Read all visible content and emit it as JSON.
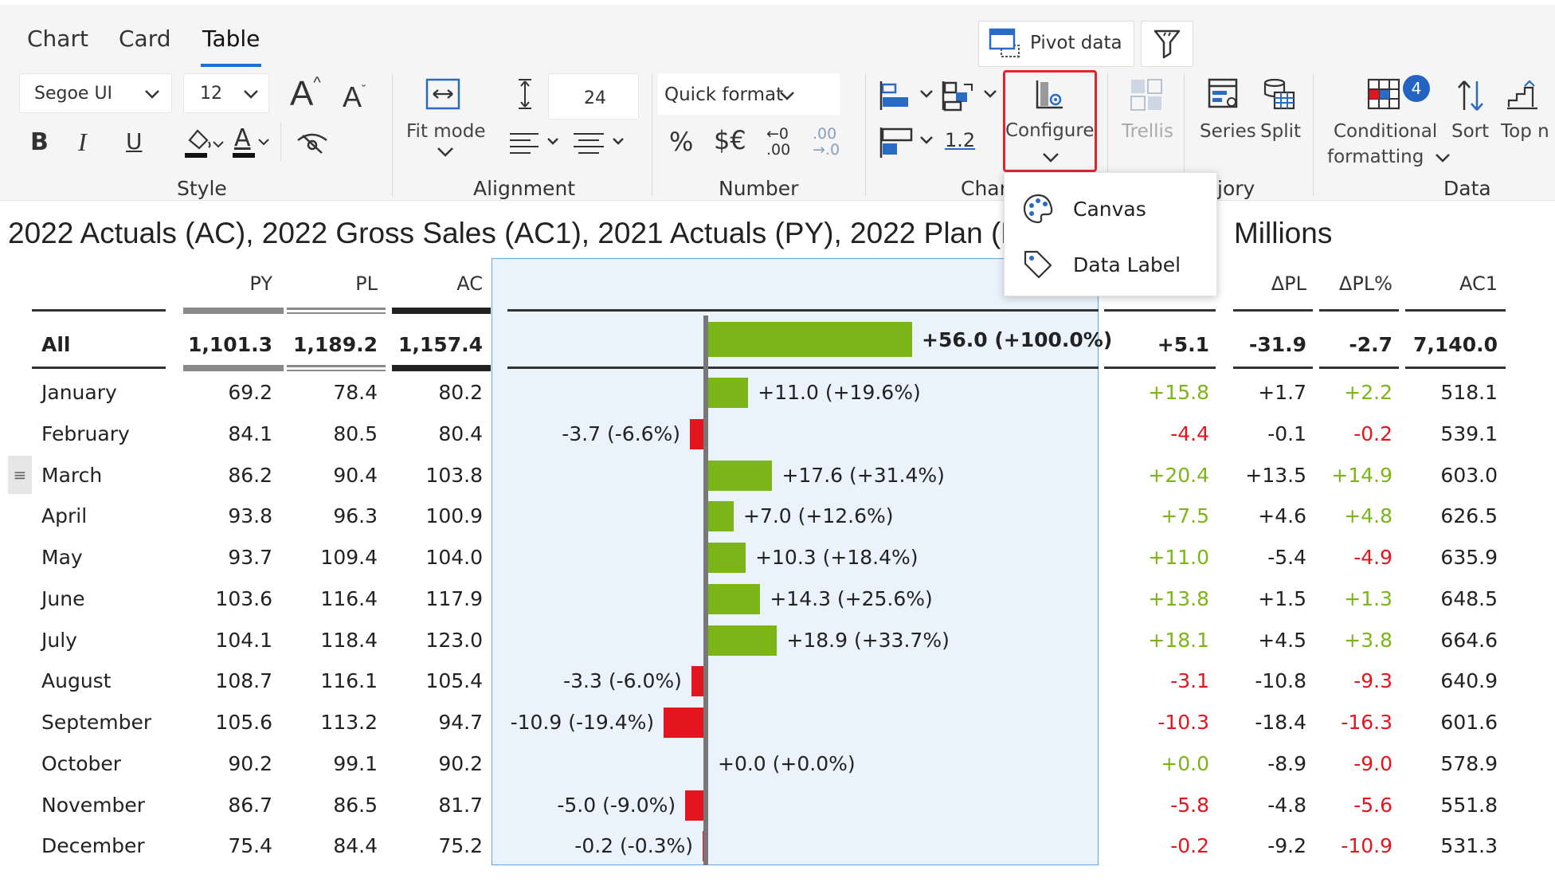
{
  "tabs": [
    {
      "label": "Chart",
      "active": false
    },
    {
      "label": "Card",
      "active": false
    },
    {
      "label": "Table",
      "active": true
    }
  ],
  "toolbar": {
    "pivot_label": "Pivot data",
    "font_family": "Segoe UI",
    "font_size": "12",
    "row_height": "24",
    "fit_mode_label": "Fit mode",
    "quick_format_label": "Quick format",
    "percent_symbol": "%",
    "currency_symbol": "$€",
    "decimal_increase_top": "←0",
    "decimal_increase_bottom": ".00",
    "decimal_decrease_top": ".00",
    "decimal_decrease_bottom": "→.0",
    "scale_value": "1.2",
    "configure_label": "Configure",
    "trellis_label": "Trellis",
    "series_label": "Series",
    "split_label": "Split",
    "conditional_label_1": "Conditional",
    "conditional_label_2": "formatting",
    "conditional_badge": "4",
    "sort_label": "Sort",
    "top_label": "Top n",
    "bold_glyph": "B",
    "italic_glyph": "I",
    "underline_glyph": "U",
    "font_grow_glyph": "A",
    "font_shrink_glyph": "A",
    "font_color_glyph": "A",
    "group_labels": {
      "style": "Style",
      "alignment": "Alignment",
      "number": "Number",
      "chart": "Char",
      "category": "jory",
      "data": "Data"
    }
  },
  "dropdown": {
    "items": [
      {
        "label": "Canvas",
        "icon": "palette-icon"
      },
      {
        "label": "Data Label",
        "icon": "tag-icon"
      }
    ]
  },
  "report": {
    "title": "2022 Actuals (AC), 2022 Gross Sales (AC1), 2021 Actuals (PY), 2022 Plan (P",
    "title_tail": "Millions"
  },
  "table": {
    "columns": [
      "PY",
      "PL",
      "AC",
      "ΔPL",
      "ΔPL%",
      "AC1"
    ],
    "total": {
      "label": "All",
      "py": "1,101.3",
      "pl": "1,189.2",
      "ac": "1,157.4",
      "bar_label": "+56.0 (+100.0%)",
      "delta": "+5.1",
      "dpl": "-31.9",
      "dplp": "-2.7",
      "ac1": "7,140.0"
    },
    "rows": [
      {
        "label": "January",
        "py": "69.2",
        "pl": "78.4",
        "ac": "80.2",
        "bar": 11.0,
        "bar_label": "+11.0 (+19.6%)",
        "delta": "+15.8",
        "dpl": "+1.7",
        "dplp": "+2.2",
        "ac1": "518.1"
      },
      {
        "label": "February",
        "py": "84.1",
        "pl": "80.5",
        "ac": "80.4",
        "bar": -3.7,
        "bar_label": "-3.7 (-6.6%)",
        "delta": "-4.4",
        "dpl": "-0.1",
        "dplp": "-0.2",
        "ac1": "539.1"
      },
      {
        "label": "March",
        "py": "86.2",
        "pl": "90.4",
        "ac": "103.8",
        "bar": 17.6,
        "bar_label": "+17.6 (+31.4%)",
        "delta": "+20.4",
        "dpl": "+13.5",
        "dplp": "+14.9",
        "ac1": "603.0"
      },
      {
        "label": "April",
        "py": "93.8",
        "pl": "96.3",
        "ac": "100.9",
        "bar": 7.0,
        "bar_label": "+7.0 (+12.6%)",
        "delta": "+7.5",
        "dpl": "+4.6",
        "dplp": "+4.8",
        "ac1": "626.5"
      },
      {
        "label": "May",
        "py": "93.7",
        "pl": "109.4",
        "ac": "104.0",
        "bar": 10.3,
        "bar_label": "+10.3 (+18.4%)",
        "delta": "+11.0",
        "dpl": "-5.4",
        "dplp": "-4.9",
        "ac1": "635.9"
      },
      {
        "label": "June",
        "py": "103.6",
        "pl": "116.4",
        "ac": "117.9",
        "bar": 14.3,
        "bar_label": "+14.3 (+25.6%)",
        "delta": "+13.8",
        "dpl": "+1.5",
        "dplp": "+1.3",
        "ac1": "648.5"
      },
      {
        "label": "July",
        "py": "104.1",
        "pl": "118.4",
        "ac": "123.0",
        "bar": 18.9,
        "bar_label": "+18.9 (+33.7%)",
        "delta": "+18.1",
        "dpl": "+4.5",
        "dplp": "+3.8",
        "ac1": "664.6"
      },
      {
        "label": "August",
        "py": "108.7",
        "pl": "116.1",
        "ac": "105.4",
        "bar": -3.3,
        "bar_label": "-3.3 (-6.0%)",
        "delta": "-3.1",
        "dpl": "-10.8",
        "dplp": "-9.3",
        "ac1": "640.9"
      },
      {
        "label": "September",
        "py": "105.6",
        "pl": "113.2",
        "ac": "94.7",
        "bar": -10.9,
        "bar_label": "-10.9 (-19.4%)",
        "delta": "-10.3",
        "dpl": "-18.4",
        "dplp": "-16.3",
        "ac1": "601.6"
      },
      {
        "label": "October",
        "py": "90.2",
        "pl": "99.1",
        "ac": "90.2",
        "bar": 0.0,
        "bar_label": "+0.0 (+0.0%)",
        "delta": "+0.0",
        "dpl": "-8.9",
        "dplp": "-9.0",
        "ac1": "578.9"
      },
      {
        "label": "November",
        "py": "86.7",
        "pl": "86.5",
        "ac": "81.7",
        "bar": -5.0,
        "bar_label": "-5.0 (-9.0%)",
        "delta": "-5.8",
        "dpl": "-4.8",
        "dplp": "-5.6",
        "ac1": "551.8"
      },
      {
        "label": "December",
        "py": "75.4",
        "pl": "84.4",
        "ac": "75.2",
        "bar": -0.2,
        "bar_label": "-0.2 (-0.3%)",
        "delta": "-0.2",
        "dpl": "-9.2",
        "dplp": "-10.9",
        "ac1": "531.3"
      }
    ]
  },
  "colors": {
    "positive": "#7cb518",
    "negative": "#e4151f",
    "accent": "#1f6fd1",
    "highlight_border": "#e0262e"
  }
}
